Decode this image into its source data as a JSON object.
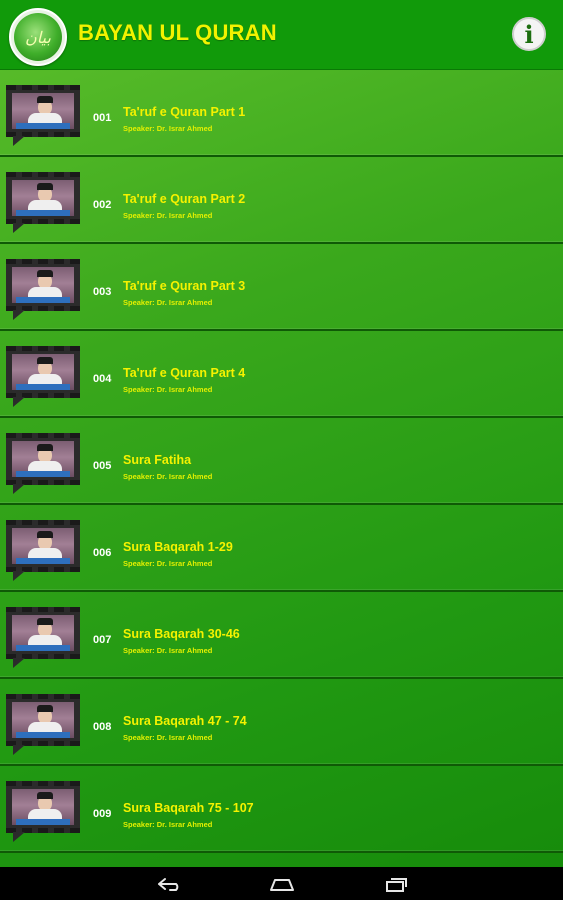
{
  "app": {
    "title": "BAYAN UL QURAN",
    "logo_text": "بیان",
    "info_glyph": "i"
  },
  "items": [
    {
      "number": "001",
      "title": "Ta'ruf e Quran Part 1",
      "speaker": "Speaker: Dr. Israr Ahmed"
    },
    {
      "number": "002",
      "title": "Ta'ruf e Quran Part 2",
      "speaker": "Speaker: Dr. Israr Ahmed"
    },
    {
      "number": "003",
      "title": "Ta'ruf e Quran Part 3",
      "speaker": "Speaker: Dr. Israr Ahmed"
    },
    {
      "number": "004",
      "title": "Ta'ruf e Quran Part 4",
      "speaker": "Speaker: Dr. Israr Ahmed"
    },
    {
      "number": "005",
      "title": "Sura Fatiha",
      "speaker": "Speaker: Dr. Israr Ahmed"
    },
    {
      "number": "006",
      "title": "Sura Baqarah 1-29",
      "speaker": "Speaker: Dr. Israr Ahmed"
    },
    {
      "number": "007",
      "title": "Sura Baqarah 30-46",
      "speaker": "Speaker: Dr. Israr Ahmed"
    },
    {
      "number": "008",
      "title": "Sura Baqarah 47 - 74",
      "speaker": "Speaker: Dr. Israr Ahmed"
    },
    {
      "number": "009",
      "title": "Sura Baqarah 75 - 107",
      "speaker": "Speaker: Dr. Israr Ahmed"
    }
  ],
  "icons": {
    "info": "info-icon",
    "logo": "app-logo-icon",
    "thumbnail": "video-film-thumbnail",
    "back": "back-icon",
    "home": "home-icon",
    "recents": "recents-icon"
  },
  "colors": {
    "appbar": "#119a0a",
    "title": "#f2f200",
    "item_title": "#f5f200",
    "item_number": "#ffffff"
  }
}
